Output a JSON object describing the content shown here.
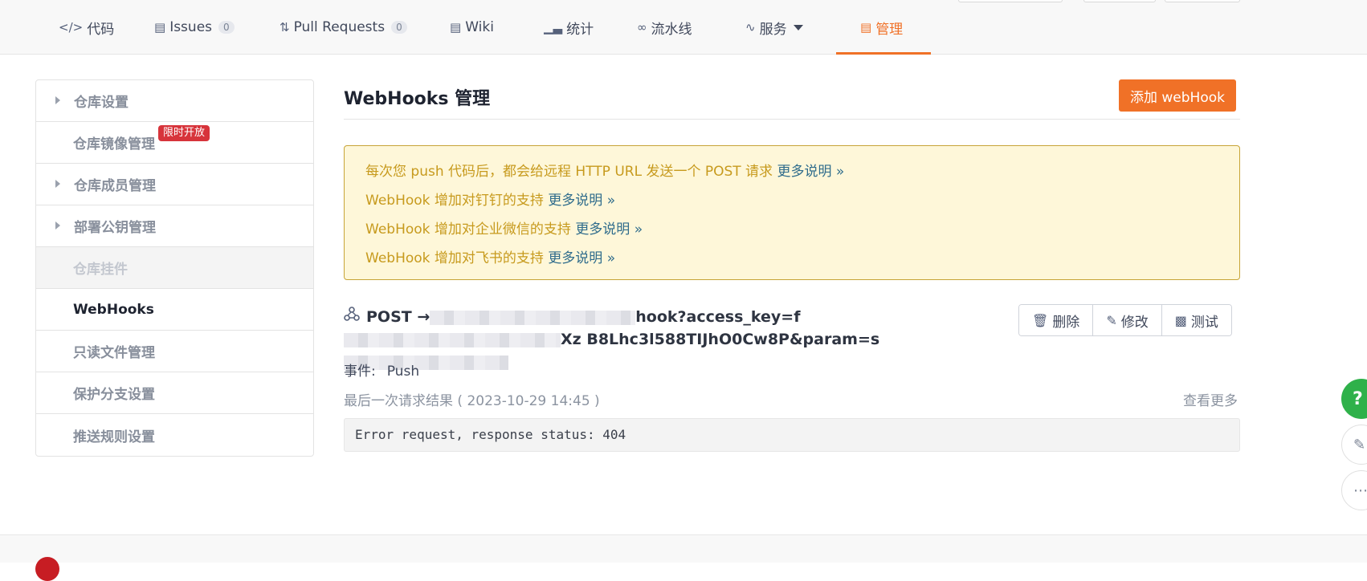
{
  "tabs": [
    {
      "label": "代码",
      "icon": "code-icon"
    },
    {
      "label": "Issues",
      "count": "0",
      "icon": "issues-icon"
    },
    {
      "label": "Pull Requests",
      "count": "0",
      "icon": "pull-request-icon"
    },
    {
      "label": "Wiki",
      "icon": "wiki-icon"
    },
    {
      "label": "统计",
      "icon": "stats-icon"
    },
    {
      "label": "流水线",
      "icon": "pipeline-icon"
    },
    {
      "label": "服务",
      "icon": "service-icon"
    },
    {
      "label": "管理",
      "icon": "manage-icon",
      "active": true
    }
  ],
  "sidebar": {
    "items": [
      {
        "label": "仓库设置"
      },
      {
        "label": "仓库镜像管理",
        "badge": "限时开放"
      },
      {
        "label": "仓库成员管理"
      },
      {
        "label": "部署公钥管理"
      },
      {
        "label": "仓库挂件"
      },
      {
        "label": "WebHooks"
      },
      {
        "label": "只读文件管理"
      },
      {
        "label": "保护分支设置"
      },
      {
        "label": "推送规则设置"
      }
    ]
  },
  "main": {
    "title": "WebHooks 管理",
    "add_button": "添加 webHook",
    "notice": [
      {
        "text": "每次您 push 代码后，都会给远程 HTTP URL 发送一个 POST 请求 ",
        "link": "更多说明 »"
      },
      {
        "text": "WebHook 增加对钉钉的支持 ",
        "link": "更多说明 »"
      },
      {
        "text": "WebHook 增加对企业微信的支持 ",
        "link": "更多说明 »"
      },
      {
        "text": "WebHook 增加对飞书的支持 ",
        "link": "更多说明 »"
      }
    ],
    "hook": {
      "method": "POST →",
      "url_part1": "hook?access_key=f",
      "url_part2": "Xz",
      "url_part3": "B8Lhc3l588TIJhO0Cw8P&param=s",
      "event_label": "事件:",
      "event_value": "Push",
      "last_result": "最后一次请求结果 ( 2023-10-29 14:45 )",
      "view_more": "查看更多",
      "response": "Error request, response status: 404",
      "buttons": {
        "delete": "删除",
        "edit": "修改",
        "test": "测试"
      }
    }
  },
  "float": {
    "help": "?"
  },
  "colors": {
    "accent": "#f07127",
    "badge": "#d7343b",
    "notice_bg": "#fef7d9",
    "notice_text": "#c79a1d",
    "link": "#2f6c8c"
  }
}
